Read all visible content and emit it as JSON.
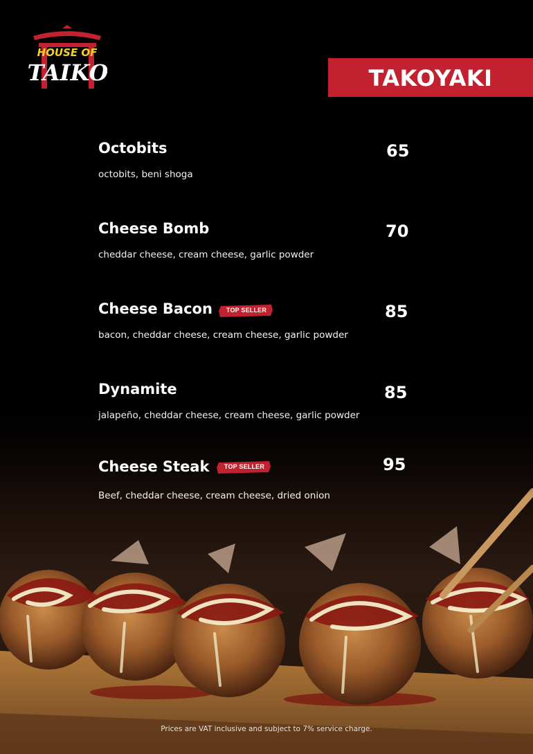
{
  "brand": {
    "logo_line1": "HOUSE OF",
    "logo_line2": "TAIKO"
  },
  "category": {
    "title": "TAKOYAKI"
  },
  "badge_label": "TOP SELLER",
  "items": [
    {
      "name": "Octobits",
      "price": "65",
      "description": "octobits, beni shoga",
      "badge": ""
    },
    {
      "name": "Cheese Bomb",
      "price": "70",
      "description": "cheddar cheese, cream cheese, garlic powder",
      "badge": ""
    },
    {
      "name": "Cheese Bacon",
      "price": "85",
      "description": "bacon, cheddar cheese, cream cheese, garlic powder",
      "badge": "TOP SELLER"
    },
    {
      "name": "Dynamite",
      "price": "85",
      "description": "jalapeño, cheddar cheese, cream cheese, garlic powder",
      "badge": ""
    },
    {
      "name": "Cheese Steak",
      "price": "95",
      "description": "Beef, cheddar cheese, cream cheese, dried onion",
      "badge": "TOP SELLER"
    }
  ],
  "footnote": "Prices are VAT inclusive and subject to 7% service charge.",
  "colors": {
    "accent": "#c2212f",
    "logo_yellow": "#f2d32a",
    "background": "#000000"
  }
}
